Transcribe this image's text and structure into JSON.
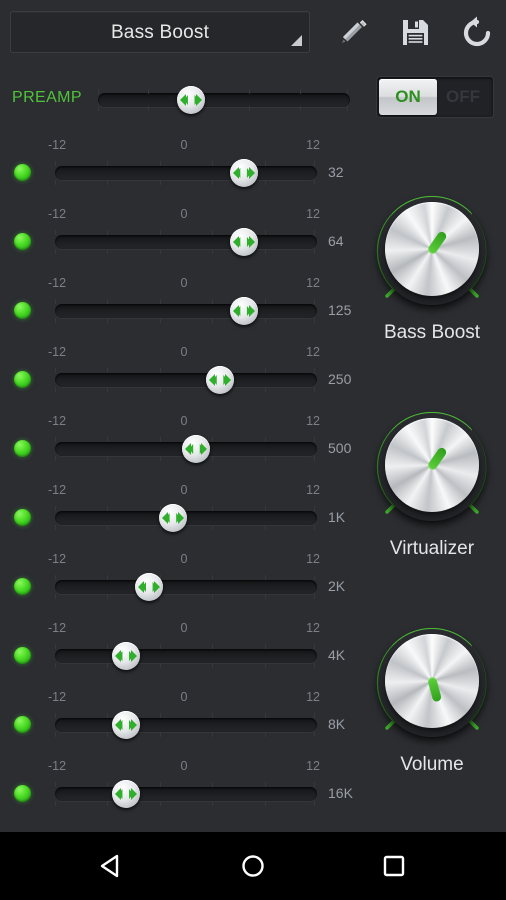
{
  "toolbar": {
    "preset_name": "Bass Boost",
    "spinner_arrow_icon": "triangle-down-right-icon",
    "edit_icon": "pencil-icon",
    "save_icon": "floppy-disk-icon",
    "reset_icon": "rotate-left-icon"
  },
  "preamp": {
    "label": "PREAMP",
    "position_pct": 37
  },
  "power": {
    "on_label": "ON",
    "off_label": "OFF",
    "state": "ON"
  },
  "scale": {
    "min": "-12",
    "mid": "0",
    "max": "12"
  },
  "bands": [
    {
      "freq": "32",
      "position_pct": 72
    },
    {
      "freq": "64",
      "position_pct": 72
    },
    {
      "freq": "125",
      "position_pct": 72
    },
    {
      "freq": "250",
      "position_pct": 63
    },
    {
      "freq": "500",
      "position_pct": 54
    },
    {
      "freq": "1K",
      "position_pct": 45
    },
    {
      "freq": "2K",
      "position_pct": 36
    },
    {
      "freq": "4K",
      "position_pct": 27
    },
    {
      "freq": "8K",
      "position_pct": 27
    },
    {
      "freq": "16K",
      "position_pct": 27
    }
  ],
  "knobs": [
    {
      "title": "Bass Boost",
      "angle_deg": 215,
      "arc_pct": 100
    },
    {
      "title": "Virtualizer",
      "angle_deg": 215,
      "arc_pct": 100
    },
    {
      "title": "Volume",
      "angle_deg": 345,
      "arc_pct": 100
    }
  ],
  "navbar": {
    "back_icon": "triangle-back-icon",
    "home_icon": "circle-home-icon",
    "recents_icon": "square-recents-icon"
  },
  "colors": {
    "accent_green": "#4fc33a",
    "background": "#2b2d31",
    "text": "#e4e5e7"
  }
}
